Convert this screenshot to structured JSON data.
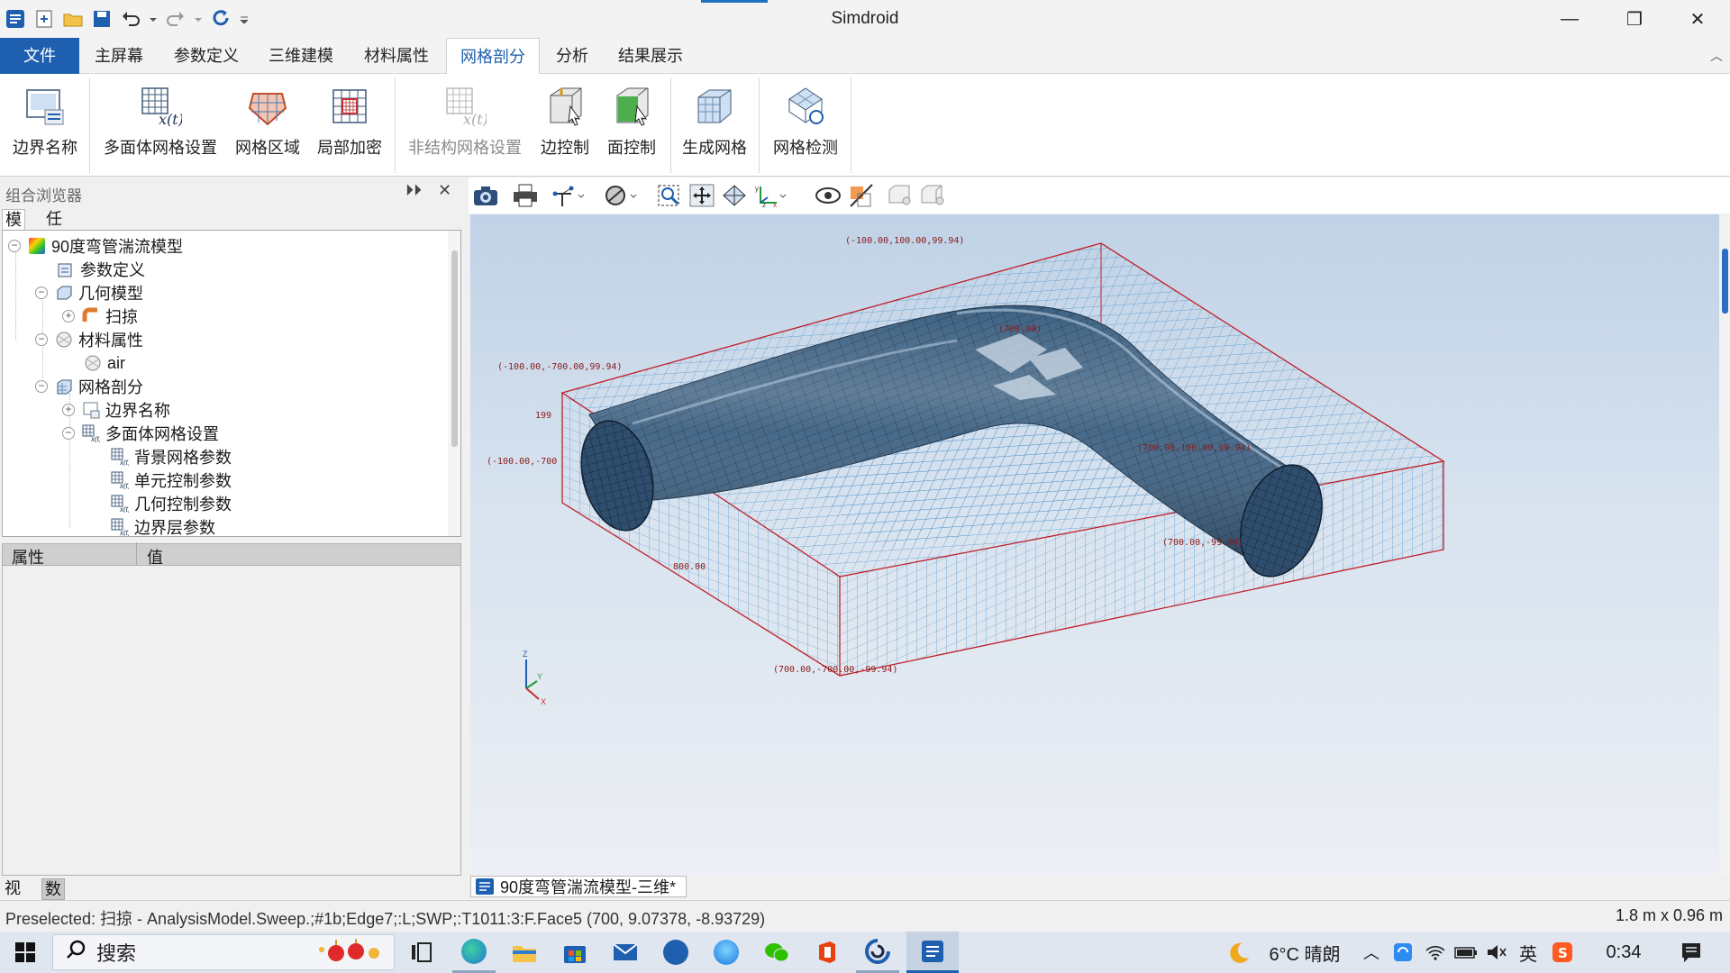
{
  "app": {
    "title": "Simdroid"
  },
  "window_controls": {
    "minimize": "—",
    "restore": "❐",
    "close": "✕"
  },
  "ribbon_tabs": [
    "文件",
    "主屏幕",
    "参数定义",
    "三维建模",
    "材料属性",
    "网格剖分",
    "分析",
    "结果展示"
  ],
  "active_tab": "网格剖分",
  "ribbon_buttons": [
    {
      "label": "边界名称",
      "icon": "boundary-name-icon",
      "enabled": true
    },
    {
      "label": "多面体网格设置",
      "icon": "polyhedral-mesh-settings-icon",
      "enabled": true
    },
    {
      "label": "网格区域",
      "icon": "mesh-region-icon",
      "enabled": true
    },
    {
      "label": "局部加密",
      "icon": "local-refinement-icon",
      "enabled": true
    },
    {
      "label": "非结构网格设置",
      "icon": "unstructured-mesh-settings-icon",
      "enabled": false
    },
    {
      "label": "边控制",
      "icon": "edge-control-icon",
      "enabled": true
    },
    {
      "label": "面控制",
      "icon": "face-control-icon",
      "enabled": true
    },
    {
      "label": "生成网格",
      "icon": "generate-mesh-icon",
      "enabled": true
    },
    {
      "label": "网格检测",
      "icon": "mesh-check-icon",
      "enabled": true
    }
  ],
  "browser": {
    "title": "组合浏览器",
    "tabs": [
      "模型",
      "任务"
    ],
    "active_tab": "模型",
    "tree": [
      {
        "label": "90度弯管湍流模型",
        "icon": "model-icon",
        "toggle": "−"
      },
      {
        "label": "参数定义",
        "icon": "parameter-icon",
        "toggle": ""
      },
      {
        "label": "几何模型",
        "icon": "geometry-icon",
        "toggle": "−"
      },
      {
        "label": "扫掠",
        "icon": "sweep-icon",
        "toggle": "+"
      },
      {
        "label": "材料属性",
        "icon": "material-icon",
        "toggle": "−"
      },
      {
        "label": "air",
        "icon": "material-item-icon",
        "toggle": ""
      },
      {
        "label": "网格剖分",
        "icon": "mesh-icon",
        "toggle": "−"
      },
      {
        "label": "边界名称",
        "icon": "boundary-name-icon",
        "toggle": "+"
      },
      {
        "label": "多面体网格设置",
        "icon": "polyhedral-mesh-settings-icon",
        "toggle": "−"
      },
      {
        "label": "背景网格参数",
        "icon": "mesh-param-icon",
        "toggle": ""
      },
      {
        "label": "单元控制参数",
        "icon": "mesh-param-icon",
        "toggle": ""
      },
      {
        "label": "几何控制参数",
        "icon": "mesh-param-icon",
        "toggle": ""
      },
      {
        "label": "边界层参数",
        "icon": "mesh-param-icon",
        "toggle": ""
      }
    ]
  },
  "properties": {
    "col_property": "属性",
    "col_value": "值"
  },
  "bottom_tabs": [
    "视图",
    "数据"
  ],
  "active_bottom_tab": "数据",
  "viewport": {
    "document_tab": "90度弯管湍流模型-三维*",
    "labels": [
      "(-100.00,100.00,99.94)",
      "(-100.00,-700.00,99.94)",
      "(-100.00,-700",
      "199",
      "(700.00)",
      "(700.00,100.00,99.94)",
      "(700.00,-99.94)",
      "800.00",
      "(700.00,-700.00,-99.94)"
    ],
    "axis": {
      "z": "Z",
      "y": "Y",
      "x": "X"
    }
  },
  "status": {
    "left": "Preselected: 扫掠 - AnalysisModel.Sweep.;#1b;Edge7;:L;SWP;:T1011:3:F.Face5 (700, 9.07378, -8.93729)",
    "right": "1.8 m x 0.96 m"
  },
  "taskbar": {
    "search_label": "搜索",
    "weather": "6°C 晴朗",
    "ime": "英",
    "time": "0:34"
  },
  "colors": {
    "accent": "#1f5fb0",
    "mesh_body": "#3d5f7f",
    "bbox": "#c0202a"
  }
}
